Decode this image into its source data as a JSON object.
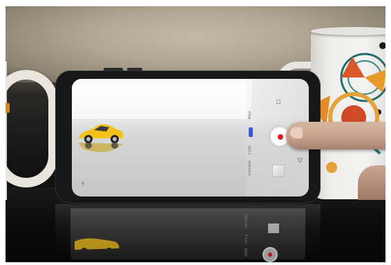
{
  "scene": {
    "camera_app": {
      "mode_labels": [
        "Retrato",
        "Foto",
        "Mas"
      ],
      "active_mode_color": "#3b5bd4",
      "shutter": {
        "icon": "record-dot-icon",
        "dot_color": "#e0182d"
      },
      "gallery_thumbnail_icon": "gallery-thumbnail-icon",
      "flash_icon": "flash-icon",
      "switch_camera_icon": "switch-camera-icon",
      "settings_icon": "settings-icon"
    },
    "subject": {
      "object": "toy-car-icon",
      "color": "#f2c21b"
    },
    "reflection_labels": [
      "Retrato",
      "Foto",
      "Mas"
    ]
  }
}
